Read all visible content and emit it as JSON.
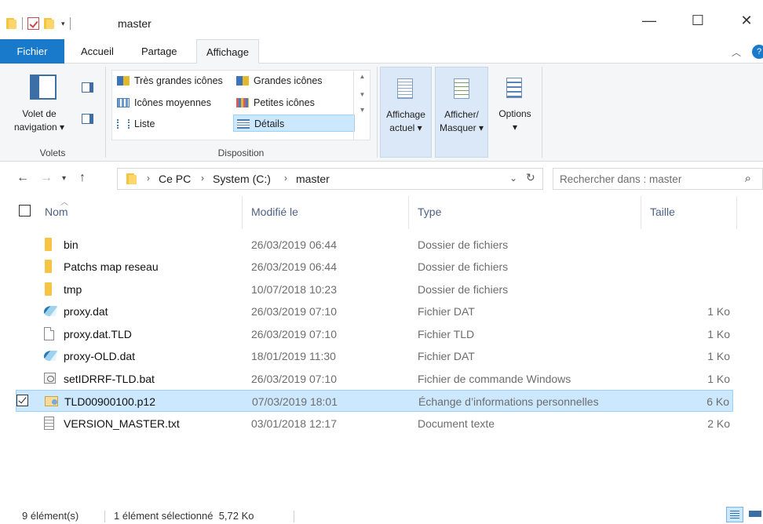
{
  "titlebar": {
    "title": "master",
    "quick_access_arrow": "▾",
    "min": "—",
    "max": "☐",
    "close": "✕"
  },
  "tabs": [
    "Fichier",
    "Accueil",
    "Partage",
    "Affichage"
  ],
  "ribbon": {
    "help": "?",
    "collapse": "︿",
    "panes_group": {
      "nav_pane_label_1": "Volet de",
      "nav_pane_label_2": "navigation ▾",
      "group_label": "Volets"
    },
    "layout_group": {
      "items": [
        "Très grandes icônes",
        "Grandes icônes",
        "Icônes moyennes",
        "Petites icônes",
        "Liste",
        "Détails"
      ],
      "selected": "Détails",
      "group_label": "Disposition"
    },
    "current_view": {
      "line1": "Affichage",
      "line2": "actuel ▾"
    },
    "show_hide": {
      "line1": "Afficher/",
      "line2": "Masquer ▾"
    },
    "options": {
      "line1": "Options",
      "line2": "▾"
    }
  },
  "address": {
    "crumbs": [
      "Ce PC",
      "System (C:)",
      "master"
    ],
    "search_placeholder": "Rechercher dans : master"
  },
  "columns": {
    "name": "Nom",
    "modified": "Modifié le",
    "type": "Type",
    "size": "Taille"
  },
  "files": [
    {
      "name": "bin",
      "date": "26/03/2019 06:44",
      "type": "Dossier de fichiers",
      "size": "",
      "icon": "folder"
    },
    {
      "name": "Patchs map reseau",
      "date": "26/03/2019 06:44",
      "type": "Dossier de fichiers",
      "size": "",
      "icon": "folder"
    },
    {
      "name": "tmp",
      "date": "10/07/2018 10:23",
      "type": "Dossier de fichiers",
      "size": "",
      "icon": "folder"
    },
    {
      "name": "proxy.dat",
      "date": "26/03/2019 07:10",
      "type": "Fichier DAT",
      "size": "1 Ko",
      "icon": "dat"
    },
    {
      "name": "proxy.dat.TLD",
      "date": "26/03/2019 07:10",
      "type": "Fichier TLD",
      "size": "1 Ko",
      "icon": "doc"
    },
    {
      "name": "proxy-OLD.dat",
      "date": "18/01/2019 11:30",
      "type": "Fichier DAT",
      "size": "1 Ko",
      "icon": "dat"
    },
    {
      "name": "setIDRRF-TLD.bat",
      "date": "26/03/2019 07:10",
      "type": "Fichier de commande Windows",
      "size": "1 Ko",
      "icon": "bat"
    },
    {
      "name": "TLD00900100.p12",
      "date": "07/03/2019 18:01",
      "type": "Échange d’informations personnelles",
      "size": "6 Ko",
      "icon": "cert",
      "selected": true
    },
    {
      "name": "VERSION_MASTER.txt",
      "date": "03/01/2018 12:17",
      "type": "Document texte",
      "size": "2 Ko",
      "icon": "txt"
    }
  ],
  "status": {
    "count": "9 élément(s)",
    "selection": "1 élément sélectionné  5,72 Ko"
  }
}
